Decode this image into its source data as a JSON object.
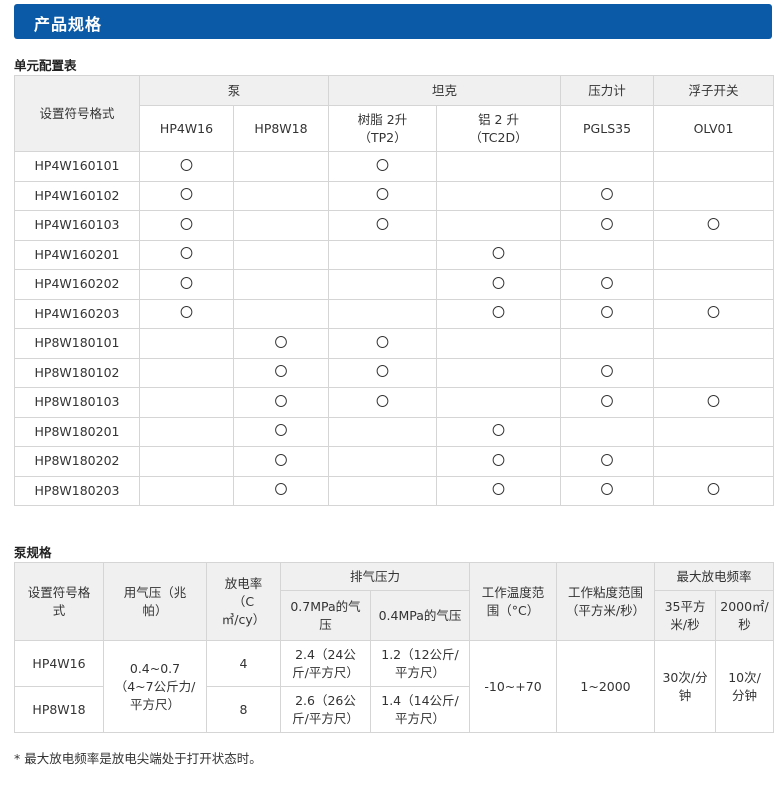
{
  "header": {
    "title": "产品规格"
  },
  "unit_table": {
    "section_title": "单元配置表",
    "corner_header": "设置符号格式",
    "groups": [
      "泵",
      "坦克",
      "压力计",
      "浮子开关"
    ],
    "subheaders": [
      "HP4W16",
      "HP8W18",
      "树脂 2升\n（TP2）",
      "铝 2 升\n（TC2D）",
      "PGLS35",
      "OLV01"
    ],
    "mark": "〇",
    "rows": [
      {
        "code": "HP4W160101",
        "marks": [
          true,
          false,
          true,
          false,
          false,
          false
        ]
      },
      {
        "code": "HP4W160102",
        "marks": [
          true,
          false,
          true,
          false,
          true,
          false
        ]
      },
      {
        "code": "HP4W160103",
        "marks": [
          true,
          false,
          true,
          false,
          true,
          true
        ]
      },
      {
        "code": "HP4W160201",
        "marks": [
          true,
          false,
          false,
          true,
          false,
          false
        ]
      },
      {
        "code": "HP4W160202",
        "marks": [
          true,
          false,
          false,
          true,
          true,
          false
        ]
      },
      {
        "code": "HP4W160203",
        "marks": [
          true,
          false,
          false,
          true,
          true,
          true
        ]
      },
      {
        "code": "HP8W180101",
        "marks": [
          false,
          true,
          true,
          false,
          false,
          false
        ]
      },
      {
        "code": "HP8W180102",
        "marks": [
          false,
          true,
          true,
          false,
          true,
          false
        ]
      },
      {
        "code": "HP8W180103",
        "marks": [
          false,
          true,
          true,
          false,
          true,
          true
        ]
      },
      {
        "code": "HP8W180201",
        "marks": [
          false,
          true,
          false,
          true,
          false,
          false
        ]
      },
      {
        "code": "HP8W180202",
        "marks": [
          false,
          true,
          false,
          true,
          true,
          false
        ]
      },
      {
        "code": "HP8W180203",
        "marks": [
          false,
          true,
          false,
          true,
          true,
          true
        ]
      }
    ]
  },
  "pump_table": {
    "section_title": "泵规格",
    "headers": {
      "code": "设置符号格式",
      "air_pressure": "用气压（兆帕）",
      "discharge_rate": "放电率（C㎥/cy）",
      "exhaust_pressure": "排气压力",
      "exhaust_07": "0.7MPa的气压",
      "exhaust_04": "0.4MPa的气压",
      "temp_range": "工作温度范围（°C）",
      "viscosity_range": "工作粘度范围（平方米/秒）",
      "max_freq": "最大放电频率",
      "freq_35": "35平方米/秒",
      "freq_2000": "2000㎡/秒"
    },
    "rows": [
      {
        "code": "HP4W16",
        "discharge_rate": "4",
        "exhaust_07": "2.4（24公斤/平方尺）",
        "exhaust_04": "1.2（12公斤/平方尺）"
      },
      {
        "code": "HP8W18",
        "discharge_rate": "8",
        "exhaust_07": "2.6（26公斤/平方尺）",
        "exhaust_04": "1.4（14公斤/平方尺）"
      }
    ],
    "shared": {
      "air_pressure": "0.4~0.7\n（4~7公斤力/平方尺）",
      "temp_range": "-10~+70",
      "viscosity_range": "1~2000",
      "freq_35": "30次/分钟",
      "freq_2000": "10次/分钟"
    }
  },
  "footnote": "* 最大放电频率是放电尖端处于打开状态时。"
}
